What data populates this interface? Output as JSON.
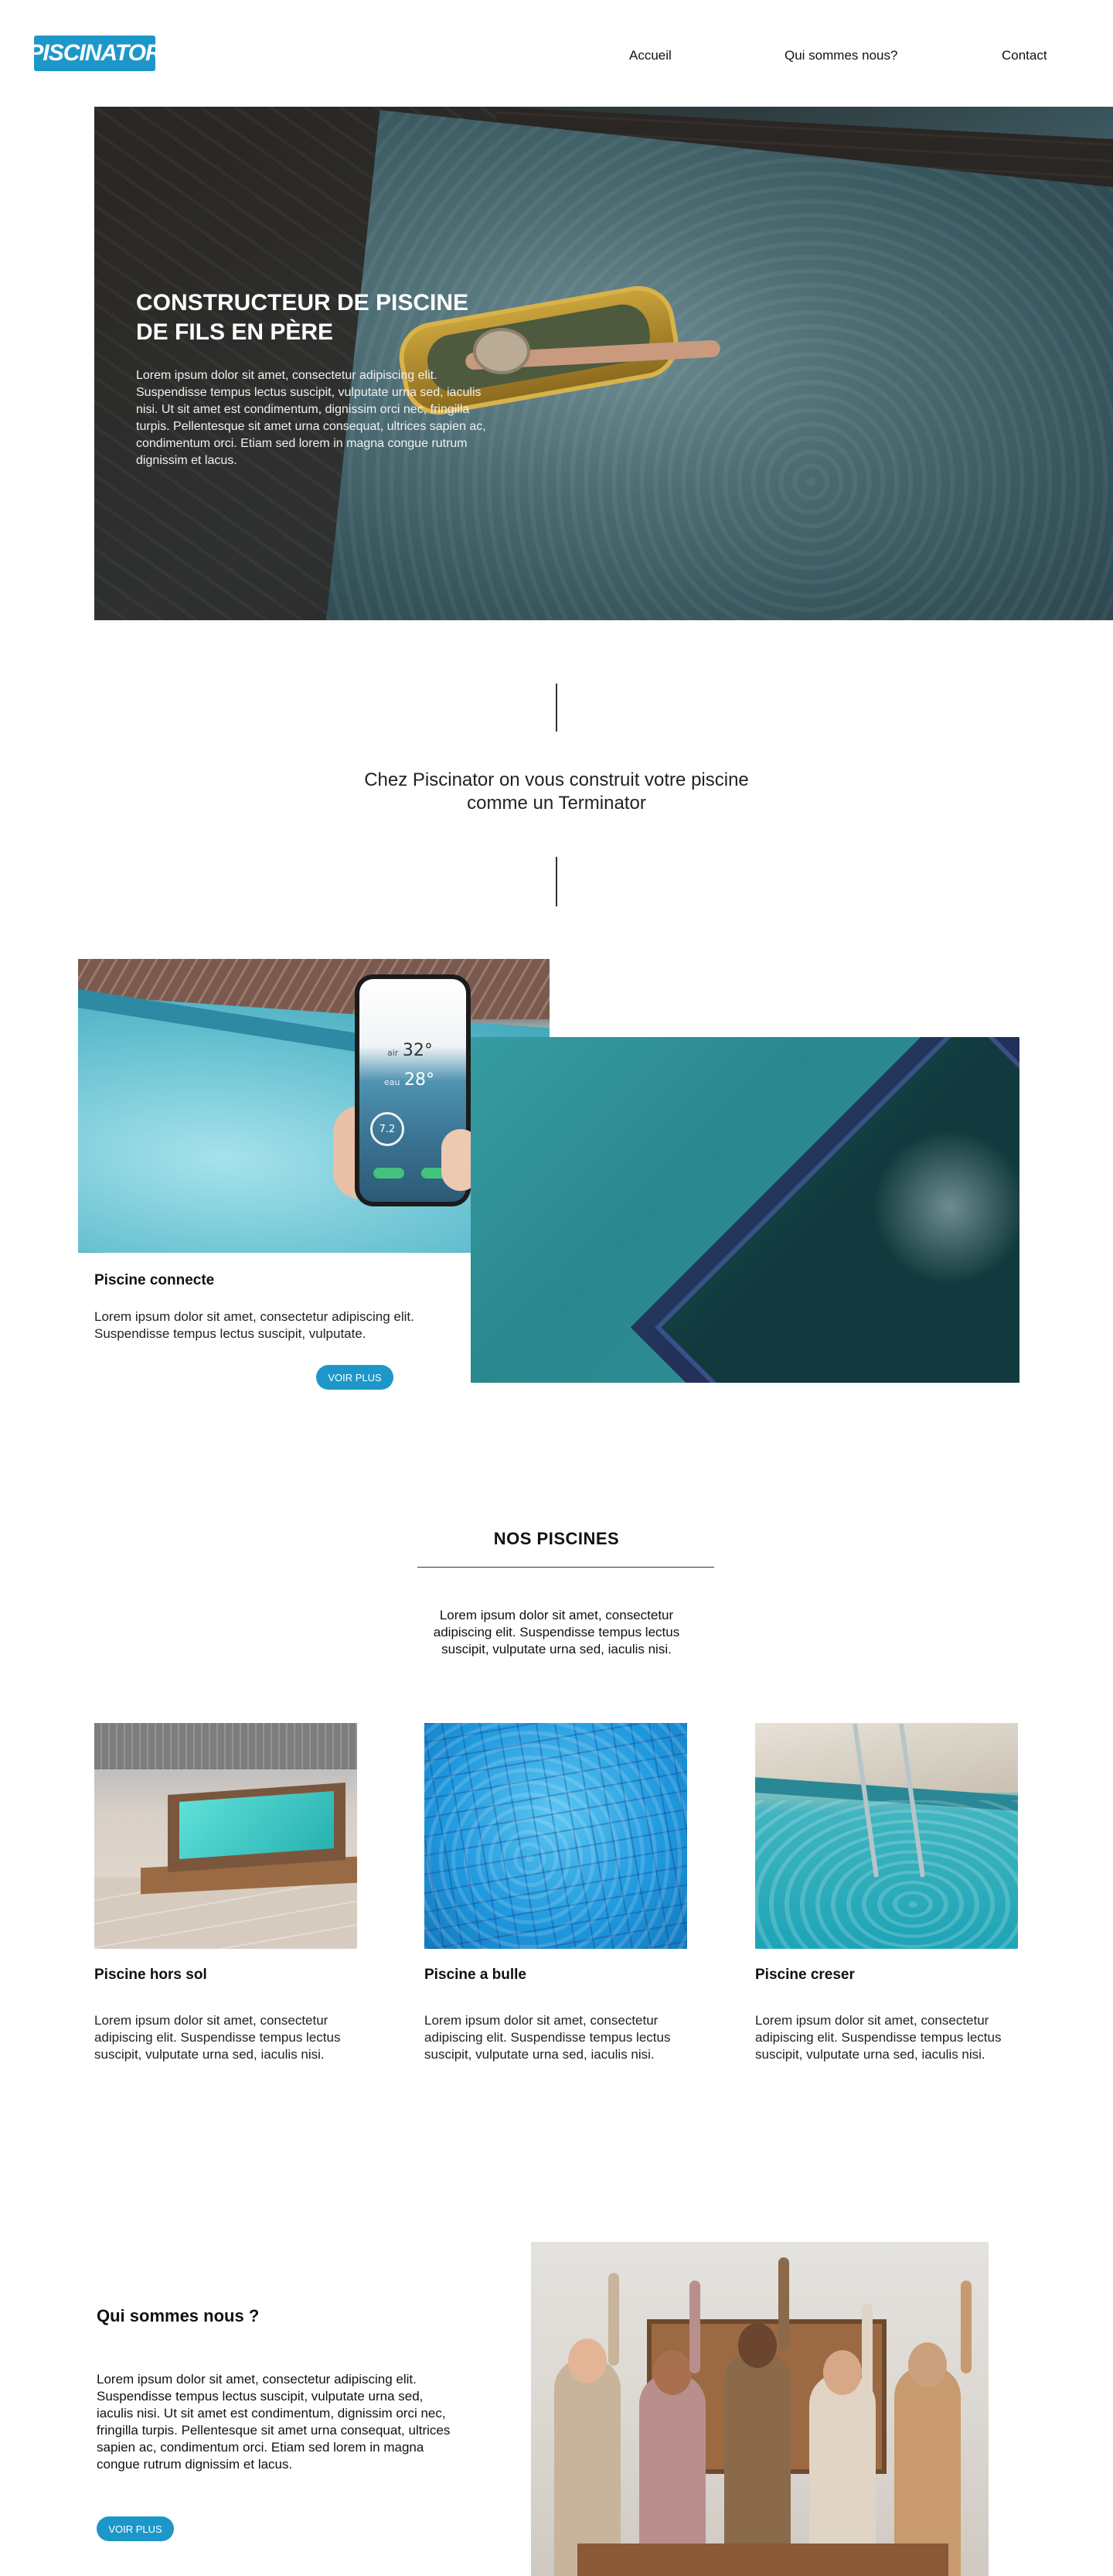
{
  "header": {
    "logo_text": "PISCINATOR",
    "nav": [
      "Accueil",
      "Qui sommes nous?",
      "Contact"
    ]
  },
  "hero": {
    "title": "CONSTRUCTEUR DE PISCINE DE FILS EN PÈRE",
    "text": "Lorem ipsum dolor sit amet, consectetur adipiscing elit. Suspendisse tempus lectus suscipit, vulputate urna sed, iaculis nisi. Ut sit amet est condimentum, dignissim orci nec, fringilla turpis. Pellentesque sit amet urna consequat, ultrices sapien ac, condimentum orci. Etiam sed lorem in magna congue rutrum dignissim et lacus."
  },
  "tagline": "Chez Piscinator on vous construit votre piscine comme un Terminator",
  "phone": {
    "air_label": "air",
    "air_value": "32°",
    "water_label": "eau",
    "water_value": "28°",
    "ph_value": "7.2"
  },
  "connected": {
    "title": "Piscine connecte",
    "text": "Lorem ipsum dolor sit amet, consectetur adipiscing elit. Suspendisse tempus lectus suscipit, vulputate.",
    "button": "VOIR PLUS"
  },
  "pools_section": {
    "title": "NOS PISCINES",
    "text": "Lorem ipsum dolor sit amet, consectetur adipiscing elit. Suspendisse tempus lectus suscipit, vulputate urna sed, iaculis nisi.",
    "cards": [
      {
        "title": "Piscine hors sol",
        "text": "Lorem ipsum dolor sit amet, consectetur adipiscing elit. Suspendisse tempus lectus suscipit, vulputate urna sed, iaculis nisi."
      },
      {
        "title": "Piscine a bulle",
        "text": "Lorem ipsum dolor sit amet, consectetur adipiscing elit. Suspendisse tempus lectus suscipit, vulputate urna sed, iaculis nisi."
      },
      {
        "title": "Piscine creser",
        "text": "Lorem ipsum dolor sit amet, consectetur adipiscing elit. Suspendisse tempus lectus suscipit, vulputate urna sed, iaculis nisi."
      }
    ]
  },
  "about": {
    "title": "Qui sommes nous ?",
    "text": "Lorem ipsum dolor sit amet, consectetur adipiscing elit. Suspendisse tempus lectus suscipit, vulputate urna sed, iaculis nisi. Ut sit amet est condimentum, dignissim orci nec, fringilla turpis. Pellentesque sit amet urna consequat, ultrices sapien ac, condimentum orci. Etiam sed lorem in magna congue rutrum dignissim et lacus.",
    "button": "VOIR PLUS"
  },
  "colors": {
    "accent": "#1d97c9",
    "text": "#111111",
    "background": "#ffffff"
  }
}
